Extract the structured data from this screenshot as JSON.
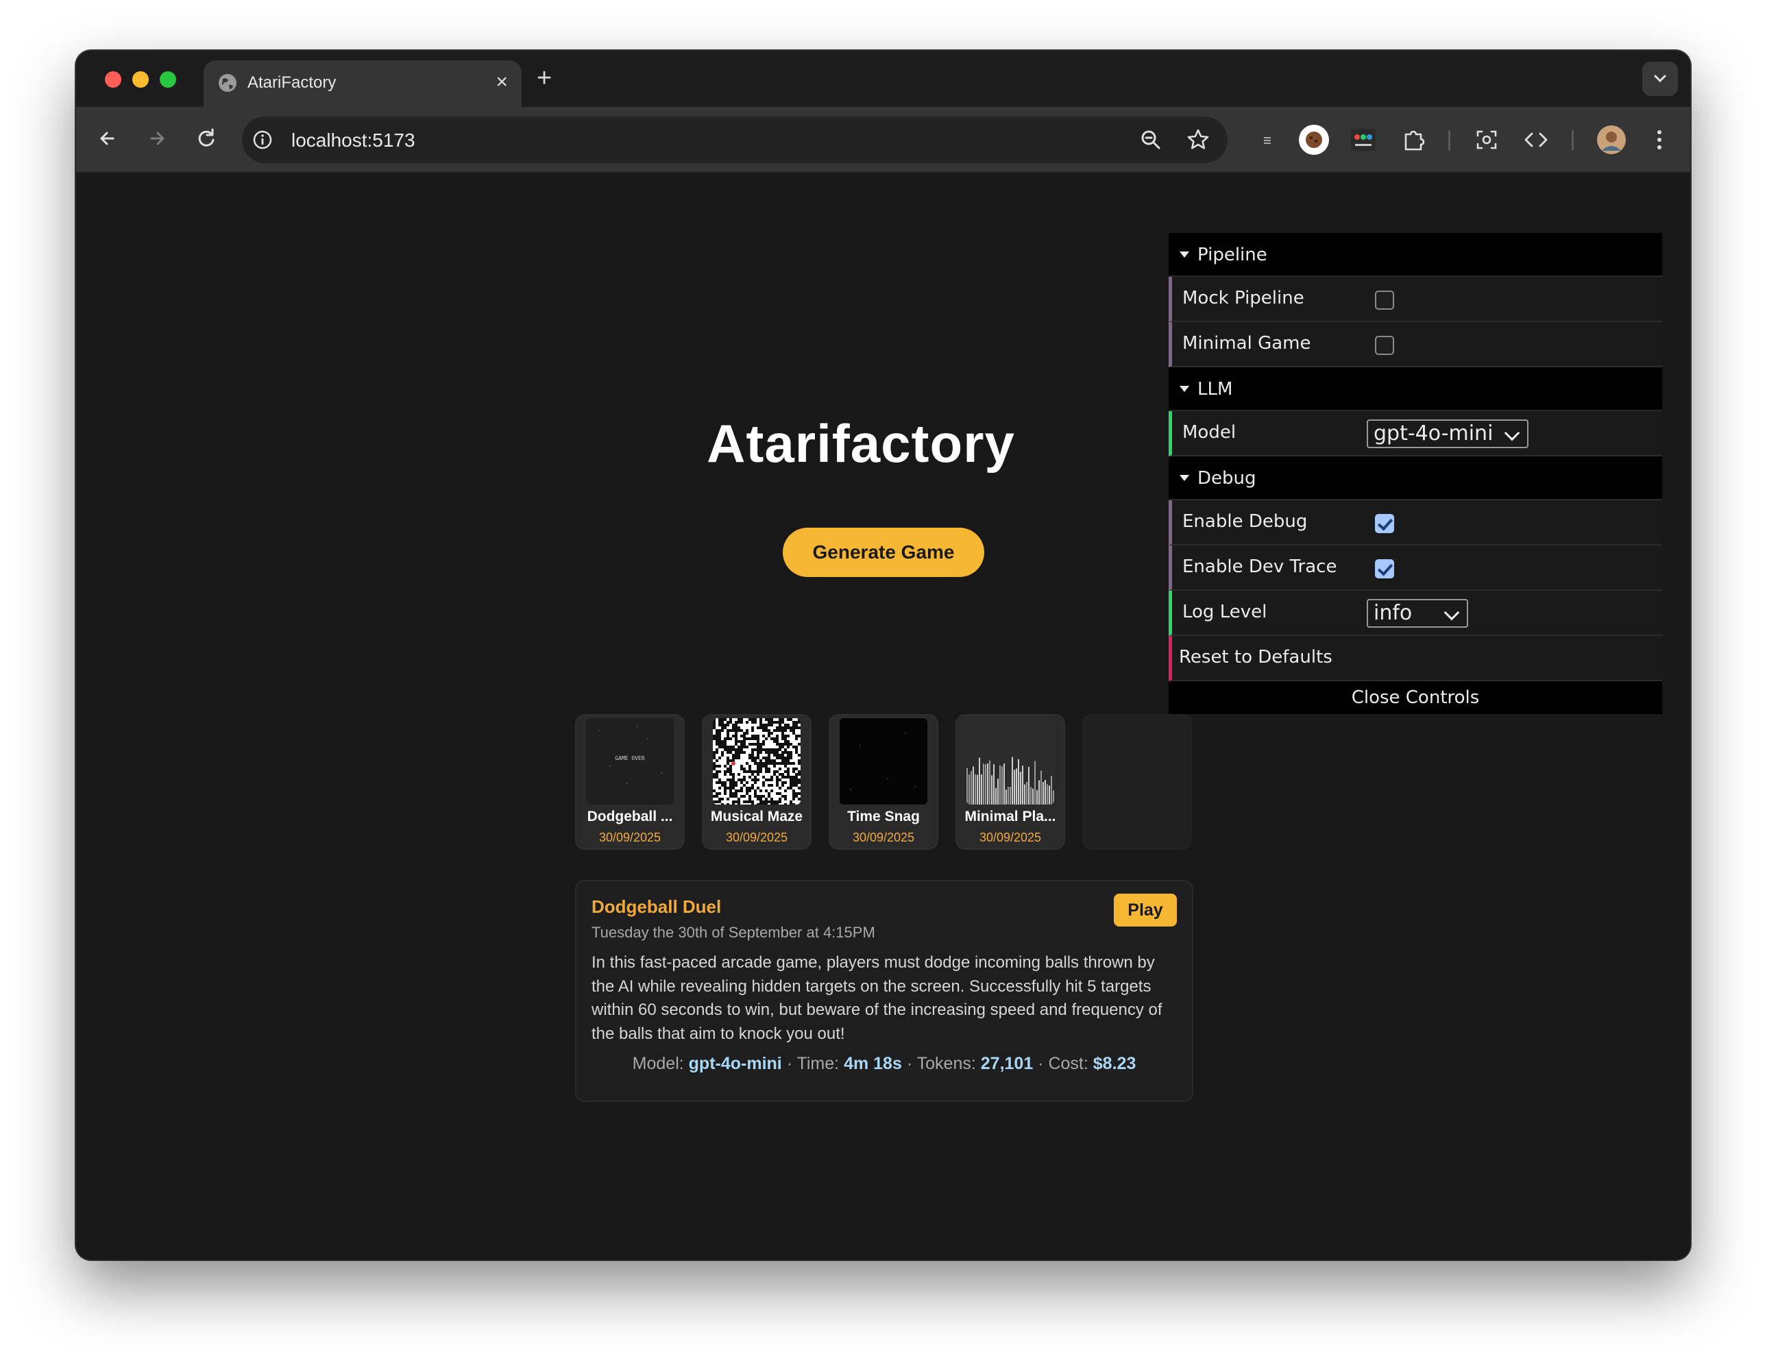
{
  "browser": {
    "tab_title": "AtariFactory",
    "new_tab_symbol": "+",
    "tab_close_symbol": "×",
    "url": "localhost:5173"
  },
  "app": {
    "title": "Atarifactory",
    "generate_button": "Generate Game"
  },
  "games": [
    {
      "name": "Dodgeball ...",
      "date": "30/09/2025",
      "thumb_text": "GAME OVER"
    },
    {
      "name": "Musical Maze",
      "date": "30/09/2025"
    },
    {
      "name": "Time Snag",
      "date": "30/09/2025"
    },
    {
      "name": "Minimal Pla...",
      "date": "30/09/2025"
    }
  ],
  "detail": {
    "title": "Dodgeball Duel",
    "date": "Tuesday the 30th of September at 4:15PM",
    "description": "In this fast-paced arcade game, players must dodge incoming balls thrown by the AI while revealing hidden targets on the screen. Successfully hit 5 targets within 60 seconds to win, but beware of the increasing speed and frequency of the balls that aim to knock you out!",
    "play_button": "Play",
    "meta": {
      "model_label": "Model:",
      "model_value": "gpt-4o-mini",
      "time_label": "Time:",
      "time_value": "4m 18s",
      "tokens_label": "Tokens:",
      "tokens_value": "27,101",
      "cost_label": "Cost:",
      "cost_value": "$8.23",
      "separator": "·"
    }
  },
  "controls": {
    "pipeline": {
      "title": "Pipeline",
      "mock_pipeline_label": "Mock Pipeline",
      "mock_pipeline_checked": false,
      "minimal_game_label": "Minimal Game",
      "minimal_game_checked": false
    },
    "llm": {
      "title": "LLM",
      "model_label": "Model",
      "model_value": "gpt-4o-mini"
    },
    "debug": {
      "title": "Debug",
      "enable_debug_label": "Enable Debug",
      "enable_debug_checked": true,
      "enable_dev_trace_label": "Enable Dev Trace",
      "enable_dev_trace_checked": true,
      "log_level_label": "Log Level",
      "log_level_value": "info"
    },
    "reset_label": "Reset to Defaults",
    "close_label": "Close Controls"
  },
  "colors": {
    "accent": "#f7b733",
    "accent_text": "#f2a93b",
    "meta_value": "#a8d8f5",
    "page_bg": "#181818"
  }
}
